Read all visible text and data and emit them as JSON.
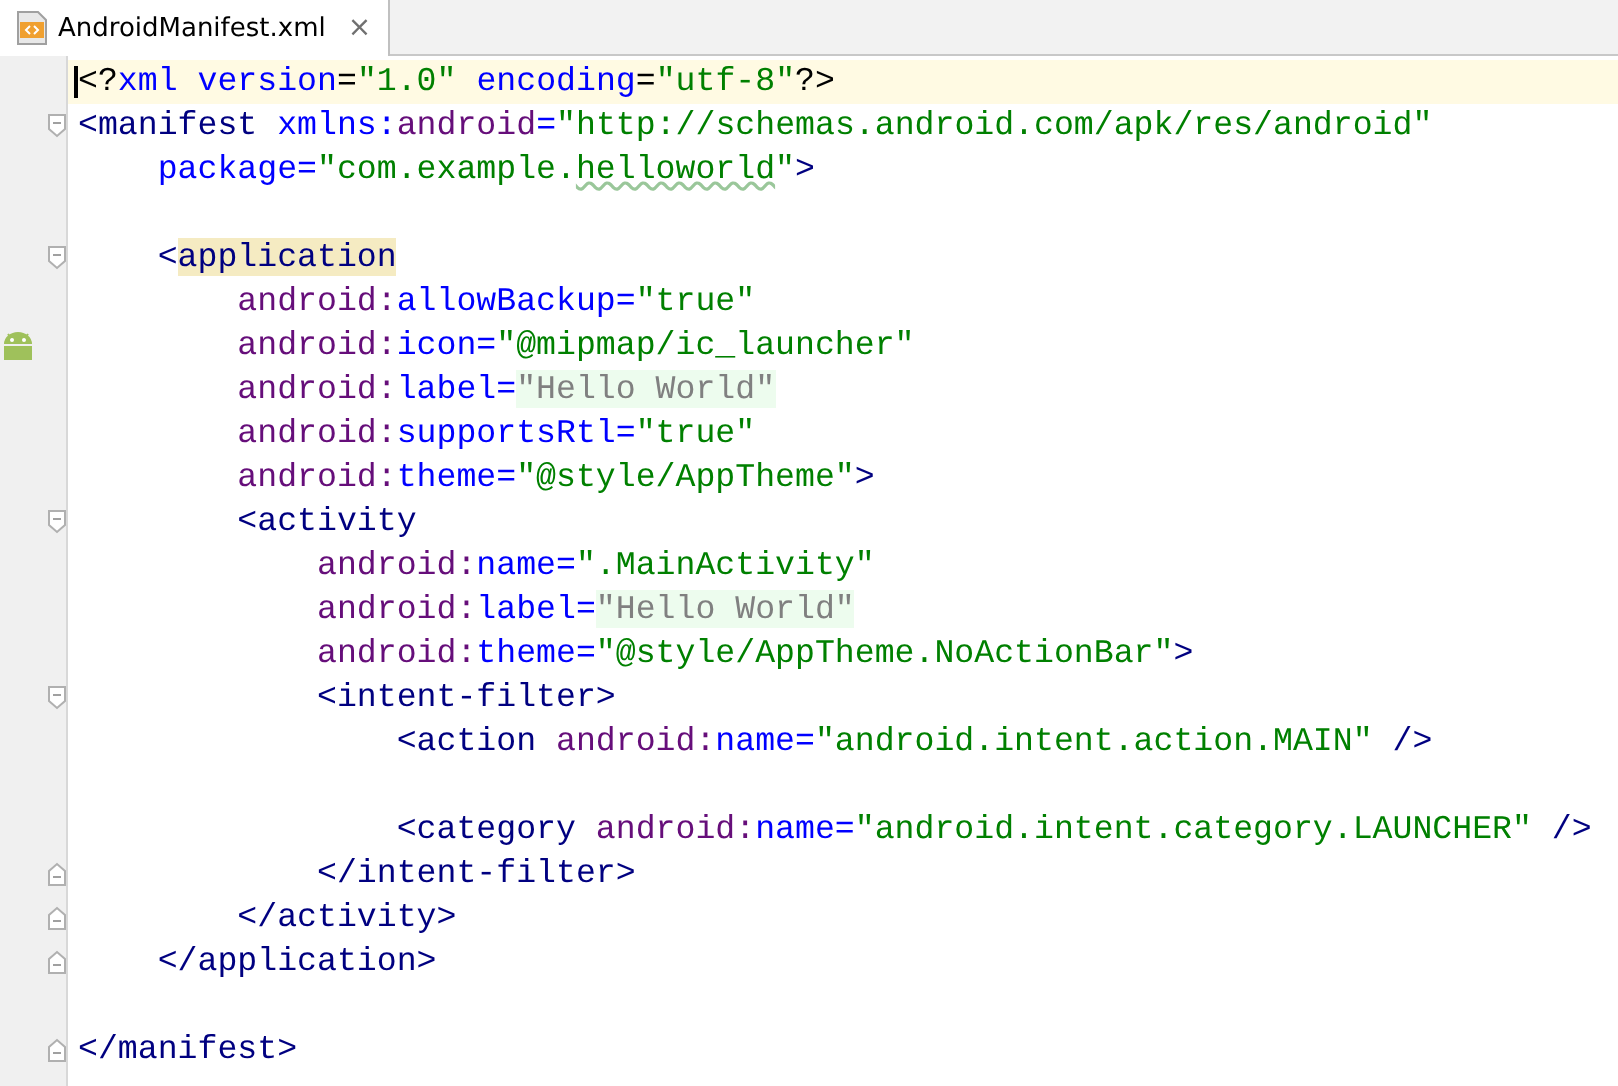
{
  "tabs": [
    {
      "label": "AndroidManifest.xml",
      "close": "×",
      "selected": true
    }
  ],
  "editor": {
    "lines": [
      {
        "current": true,
        "tokens": [
          {
            "kind": "punct",
            "text": "<?"
          },
          {
            "kind": "attr",
            "text": "xml version"
          },
          {
            "kind": "punct",
            "text": "="
          },
          {
            "kind": "str",
            "text": "\"1.0\""
          },
          {
            "kind": "attr",
            "text": " encoding"
          },
          {
            "kind": "punct",
            "text": "="
          },
          {
            "kind": "str",
            "text": "\"utf-8\""
          },
          {
            "kind": "punct",
            "text": "?>"
          }
        ]
      },
      {
        "current": false,
        "fold": {
          "kind": "start"
        },
        "tokens": [
          {
            "kind": "tag",
            "text": "<manifest "
          },
          {
            "kind": "attr",
            "text": "xmlns:"
          },
          {
            "kind": "ns",
            "text": "android"
          },
          {
            "kind": "attr",
            "text": "="
          },
          {
            "kind": "str",
            "text": "\"http://schemas.android.com/apk/res/android\""
          }
        ]
      },
      {
        "current": false,
        "tokens": [
          {
            "kind": "attr",
            "text": "    package="
          },
          {
            "kind": "str",
            "text": "\"com.example."
          },
          {
            "kind": "typo",
            "text": "helloworld"
          },
          {
            "kind": "str",
            "text": "\""
          },
          {
            "kind": "tag",
            "text": ">"
          }
        ]
      },
      {
        "current": false
      },
      {
        "current": false,
        "fold": {
          "kind": "start"
        },
        "tokens": [
          {
            "kind": "tag",
            "text": "    <"
          },
          {
            "kind": "match",
            "text": "application"
          }
        ]
      },
      {
        "current": false,
        "tokens": [
          {
            "kind": "ns",
            "text": "        android:"
          },
          {
            "kind": "attr",
            "text": "allowBackup="
          },
          {
            "kind": "str",
            "text": "\"true\""
          }
        ]
      },
      {
        "current": false,
        "gutter": {
          "kind": "android"
        },
        "tokens": [
          {
            "kind": "ns",
            "text": "        android:"
          },
          {
            "kind": "attr",
            "text": "icon="
          },
          {
            "kind": "str",
            "text": "\"@mipmap/ic_launcher\""
          }
        ]
      },
      {
        "current": false,
        "tokens": [
          {
            "kind": "ns",
            "text": "        android:"
          },
          {
            "kind": "attr",
            "text": "label="
          },
          {
            "kind": "hardcoded",
            "text": "\"Hello World\""
          }
        ]
      },
      {
        "current": false,
        "tokens": [
          {
            "kind": "ns",
            "text": "        android:"
          },
          {
            "kind": "attr",
            "text": "supportsRtl="
          },
          {
            "kind": "str",
            "text": "\"true\""
          }
        ]
      },
      {
        "current": false,
        "tokens": [
          {
            "kind": "ns",
            "text": "        android:"
          },
          {
            "kind": "attr",
            "text": "theme="
          },
          {
            "kind": "str",
            "text": "\"@style/AppTheme\""
          },
          {
            "kind": "tag",
            "text": ">"
          }
        ]
      },
      {
        "current": false,
        "fold": {
          "kind": "start"
        },
        "tokens": [
          {
            "kind": "tag",
            "text": "        <activity"
          }
        ]
      },
      {
        "current": false,
        "tokens": [
          {
            "kind": "ns",
            "text": "            android:"
          },
          {
            "kind": "attr",
            "text": "name="
          },
          {
            "kind": "str",
            "text": "\".MainActivity\""
          }
        ]
      },
      {
        "current": false,
        "tokens": [
          {
            "kind": "ns",
            "text": "            android:"
          },
          {
            "kind": "attr",
            "text": "label="
          },
          {
            "kind": "hardcoded",
            "text": "\"Hello World\""
          }
        ]
      },
      {
        "current": false,
        "tokens": [
          {
            "kind": "ns",
            "text": "            android:"
          },
          {
            "kind": "attr",
            "text": "theme="
          },
          {
            "kind": "str",
            "text": "\"@style/AppTheme.NoActionBar\""
          },
          {
            "kind": "tag",
            "text": ">"
          }
        ]
      },
      {
        "current": false,
        "fold": {
          "kind": "start"
        },
        "tokens": [
          {
            "kind": "tag",
            "text": "            <intent-filter>"
          }
        ]
      },
      {
        "current": false,
        "tokens": [
          {
            "kind": "tag",
            "text": "                <action "
          },
          {
            "kind": "ns",
            "text": "android:"
          },
          {
            "kind": "attr",
            "text": "name="
          },
          {
            "kind": "str",
            "text": "\"android.intent.action.MAIN\""
          },
          {
            "kind": "tag",
            "text": " />"
          }
        ]
      },
      {
        "current": false
      },
      {
        "current": false,
        "tokens": [
          {
            "kind": "tag",
            "text": "                <category "
          },
          {
            "kind": "ns",
            "text": "android:"
          },
          {
            "kind": "attr",
            "text": "name="
          },
          {
            "kind": "str",
            "text": "\"android.intent.category.LAUNCHER\""
          },
          {
            "kind": "tag",
            "text": " />"
          }
        ]
      },
      {
        "current": false,
        "fold": {
          "kind": "end"
        },
        "tokens": [
          {
            "kind": "tag",
            "text": "            </intent-filter>"
          }
        ]
      },
      {
        "current": false,
        "fold": {
          "kind": "end"
        },
        "tokens": [
          {
            "kind": "tag",
            "text": "        </activity>"
          }
        ]
      },
      {
        "current": false,
        "fold": {
          "kind": "end"
        },
        "tokens": [
          {
            "kind": "tag",
            "text": "    </application>"
          }
        ]
      },
      {
        "current": false
      },
      {
        "current": false,
        "fold": {
          "kind": "end"
        },
        "tokens": [
          {
            "kind": "tag",
            "text": "</manifest>"
          }
        ]
      }
    ]
  }
}
